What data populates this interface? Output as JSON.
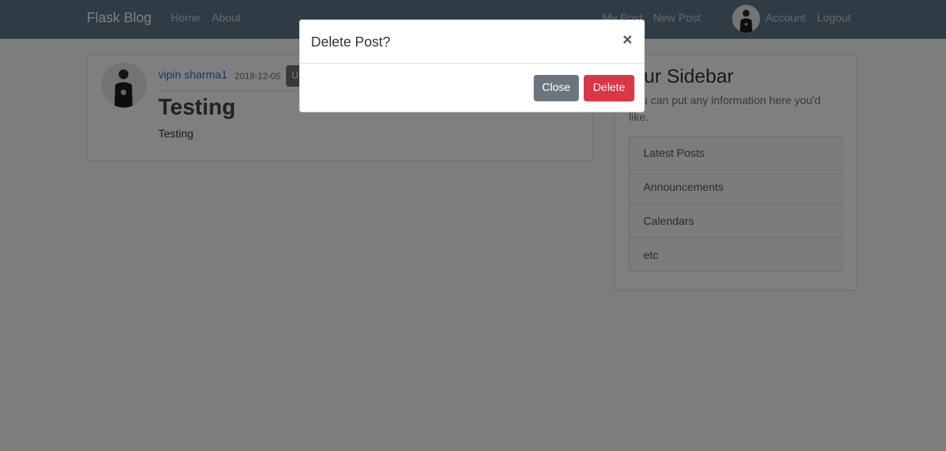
{
  "navbar": {
    "brand": "Flask Blog",
    "left_links": [
      "Home",
      "About"
    ],
    "right_links": [
      "My Post",
      "New Post",
      "Account",
      "Logout"
    ]
  },
  "post": {
    "author": "vipin sharma1",
    "date": "2018-12-05",
    "update_label": "Update",
    "title": "Testing",
    "content": "Testing"
  },
  "sidebar": {
    "title": "Our Sidebar",
    "text": "You can put any information here you'd like.",
    "items": [
      "Latest Posts",
      "Announcements",
      "Calendars",
      "etc"
    ]
  },
  "modal": {
    "title": "Delete Post?",
    "close_icon": "×",
    "close_label": "Close",
    "delete_label": "Delete"
  }
}
